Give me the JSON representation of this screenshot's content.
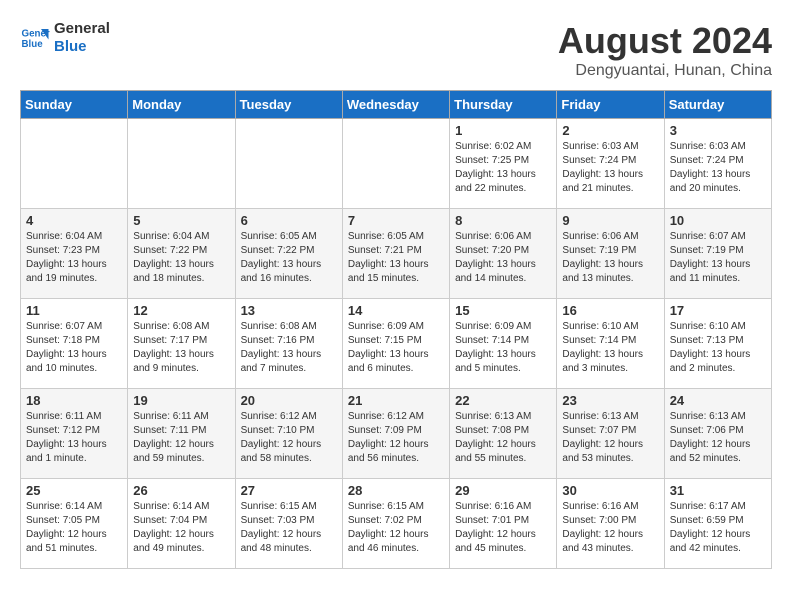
{
  "header": {
    "logo_line1": "General",
    "logo_line2": "Blue",
    "month_year": "August 2024",
    "location": "Dengyuantai, Hunan, China"
  },
  "days_of_week": [
    "Sunday",
    "Monday",
    "Tuesday",
    "Wednesday",
    "Thursday",
    "Friday",
    "Saturday"
  ],
  "weeks": [
    [
      {
        "day": "",
        "info": ""
      },
      {
        "day": "",
        "info": ""
      },
      {
        "day": "",
        "info": ""
      },
      {
        "day": "",
        "info": ""
      },
      {
        "day": "1",
        "info": "Sunrise: 6:02 AM\nSunset: 7:25 PM\nDaylight: 13 hours\nand 22 minutes."
      },
      {
        "day": "2",
        "info": "Sunrise: 6:03 AM\nSunset: 7:24 PM\nDaylight: 13 hours\nand 21 minutes."
      },
      {
        "day": "3",
        "info": "Sunrise: 6:03 AM\nSunset: 7:24 PM\nDaylight: 13 hours\nand 20 minutes."
      }
    ],
    [
      {
        "day": "4",
        "info": "Sunrise: 6:04 AM\nSunset: 7:23 PM\nDaylight: 13 hours\nand 19 minutes."
      },
      {
        "day": "5",
        "info": "Sunrise: 6:04 AM\nSunset: 7:22 PM\nDaylight: 13 hours\nand 18 minutes."
      },
      {
        "day": "6",
        "info": "Sunrise: 6:05 AM\nSunset: 7:22 PM\nDaylight: 13 hours\nand 16 minutes."
      },
      {
        "day": "7",
        "info": "Sunrise: 6:05 AM\nSunset: 7:21 PM\nDaylight: 13 hours\nand 15 minutes."
      },
      {
        "day": "8",
        "info": "Sunrise: 6:06 AM\nSunset: 7:20 PM\nDaylight: 13 hours\nand 14 minutes."
      },
      {
        "day": "9",
        "info": "Sunrise: 6:06 AM\nSunset: 7:19 PM\nDaylight: 13 hours\nand 13 minutes."
      },
      {
        "day": "10",
        "info": "Sunrise: 6:07 AM\nSunset: 7:19 PM\nDaylight: 13 hours\nand 11 minutes."
      }
    ],
    [
      {
        "day": "11",
        "info": "Sunrise: 6:07 AM\nSunset: 7:18 PM\nDaylight: 13 hours\nand 10 minutes."
      },
      {
        "day": "12",
        "info": "Sunrise: 6:08 AM\nSunset: 7:17 PM\nDaylight: 13 hours\nand 9 minutes."
      },
      {
        "day": "13",
        "info": "Sunrise: 6:08 AM\nSunset: 7:16 PM\nDaylight: 13 hours\nand 7 minutes."
      },
      {
        "day": "14",
        "info": "Sunrise: 6:09 AM\nSunset: 7:15 PM\nDaylight: 13 hours\nand 6 minutes."
      },
      {
        "day": "15",
        "info": "Sunrise: 6:09 AM\nSunset: 7:14 PM\nDaylight: 13 hours\nand 5 minutes."
      },
      {
        "day": "16",
        "info": "Sunrise: 6:10 AM\nSunset: 7:14 PM\nDaylight: 13 hours\nand 3 minutes."
      },
      {
        "day": "17",
        "info": "Sunrise: 6:10 AM\nSunset: 7:13 PM\nDaylight: 13 hours\nand 2 minutes."
      }
    ],
    [
      {
        "day": "18",
        "info": "Sunrise: 6:11 AM\nSunset: 7:12 PM\nDaylight: 13 hours\nand 1 minute."
      },
      {
        "day": "19",
        "info": "Sunrise: 6:11 AM\nSunset: 7:11 PM\nDaylight: 12 hours\nand 59 minutes."
      },
      {
        "day": "20",
        "info": "Sunrise: 6:12 AM\nSunset: 7:10 PM\nDaylight: 12 hours\nand 58 minutes."
      },
      {
        "day": "21",
        "info": "Sunrise: 6:12 AM\nSunset: 7:09 PM\nDaylight: 12 hours\nand 56 minutes."
      },
      {
        "day": "22",
        "info": "Sunrise: 6:13 AM\nSunset: 7:08 PM\nDaylight: 12 hours\nand 55 minutes."
      },
      {
        "day": "23",
        "info": "Sunrise: 6:13 AM\nSunset: 7:07 PM\nDaylight: 12 hours\nand 53 minutes."
      },
      {
        "day": "24",
        "info": "Sunrise: 6:13 AM\nSunset: 7:06 PM\nDaylight: 12 hours\nand 52 minutes."
      }
    ],
    [
      {
        "day": "25",
        "info": "Sunrise: 6:14 AM\nSunset: 7:05 PM\nDaylight: 12 hours\nand 51 minutes."
      },
      {
        "day": "26",
        "info": "Sunrise: 6:14 AM\nSunset: 7:04 PM\nDaylight: 12 hours\nand 49 minutes."
      },
      {
        "day": "27",
        "info": "Sunrise: 6:15 AM\nSunset: 7:03 PM\nDaylight: 12 hours\nand 48 minutes."
      },
      {
        "day": "28",
        "info": "Sunrise: 6:15 AM\nSunset: 7:02 PM\nDaylight: 12 hours\nand 46 minutes."
      },
      {
        "day": "29",
        "info": "Sunrise: 6:16 AM\nSunset: 7:01 PM\nDaylight: 12 hours\nand 45 minutes."
      },
      {
        "day": "30",
        "info": "Sunrise: 6:16 AM\nSunset: 7:00 PM\nDaylight: 12 hours\nand 43 minutes."
      },
      {
        "day": "31",
        "info": "Sunrise: 6:17 AM\nSunset: 6:59 PM\nDaylight: 12 hours\nand 42 minutes."
      }
    ]
  ]
}
